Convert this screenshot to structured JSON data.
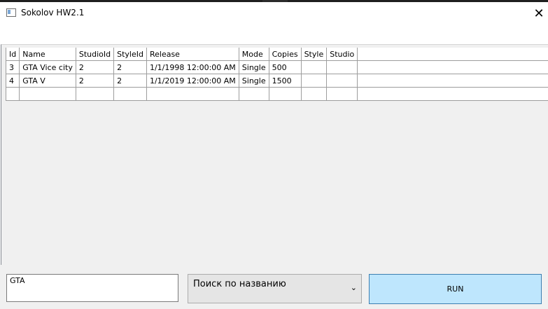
{
  "window": {
    "title": "Sokolov HW2.1",
    "close_glyph": "✕"
  },
  "grid": {
    "columns": [
      "Id",
      "Name",
      "StudioId",
      "StyleId",
      "Release",
      "Mode",
      "Copies",
      "Style",
      "Studio"
    ],
    "rows": [
      [
        "3",
        "GTA Vice city",
        "2",
        "2",
        "1/1/1998 12:00:00 AM",
        "Single",
        "500",
        "",
        ""
      ],
      [
        "4",
        "GTA V",
        "2",
        "2",
        "1/1/2019 12:00:00 AM",
        "Single",
        "1500",
        "",
        ""
      ]
    ]
  },
  "controls": {
    "search_value": "GTA",
    "search_mode": "Поиск по названию",
    "run_label": "RUN"
  }
}
